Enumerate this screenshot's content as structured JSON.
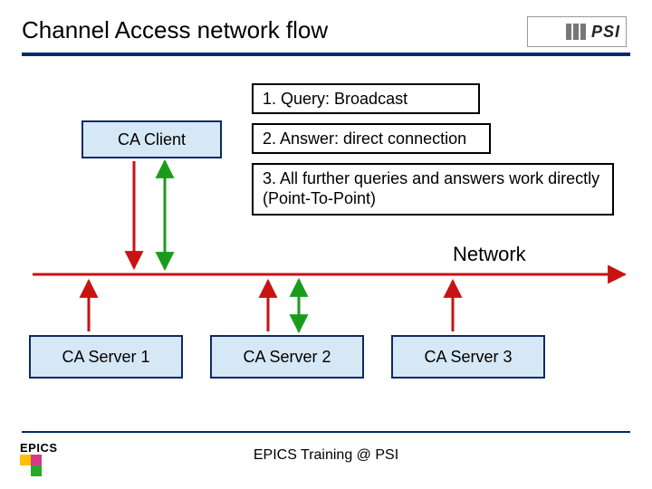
{
  "title": "Channel Access network flow",
  "boxes": {
    "client": "CA Client",
    "step1": "1. Query: Broadcast",
    "step2": "2. Answer: direct connection",
    "step3": "3. All further queries and answers work directly (Point-To-Point)",
    "server1": "CA Server 1",
    "server2": "CA Server 2",
    "server3": "CA Server 3"
  },
  "network_label": "Network",
  "footer": "EPICS Training @ PSI",
  "epics_label": "EPICS",
  "psi_label": "PSI",
  "colors": {
    "red": "#c91212",
    "green": "#1b9b1b",
    "navy": "#002a6c",
    "box_fill": "#d6e7f5"
  }
}
